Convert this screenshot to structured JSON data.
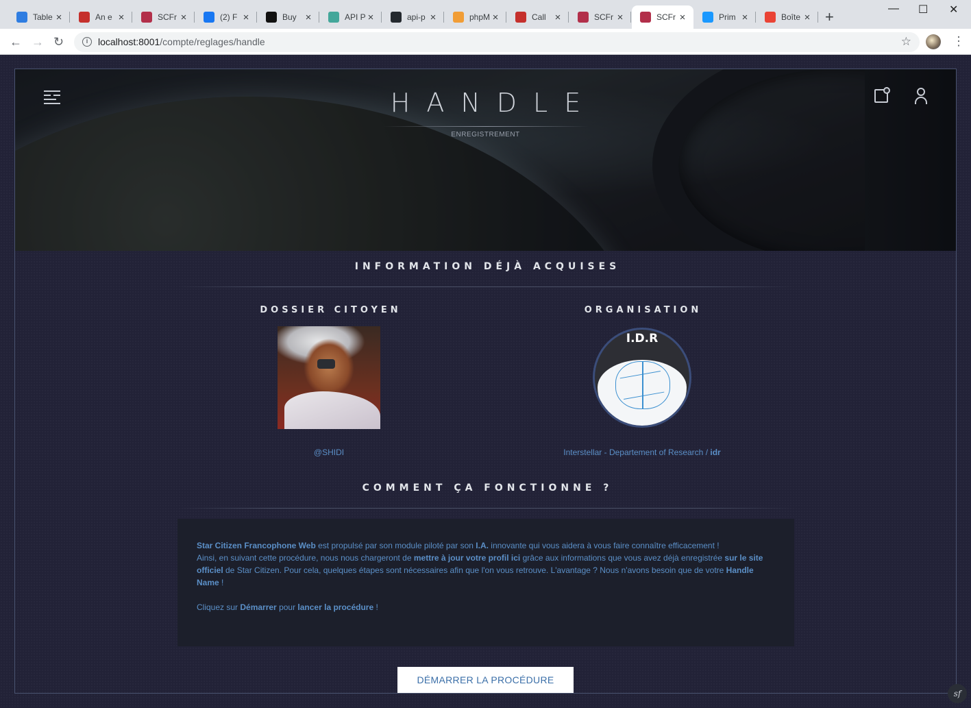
{
  "browser": {
    "tabs": [
      {
        "title": "Table",
        "color": "#2f7de1"
      },
      {
        "title": "An e",
        "color": "#c5302c"
      },
      {
        "title": "SCFr",
        "color": "#b22f4a"
      },
      {
        "title": "(2) F",
        "color": "#1877f2"
      },
      {
        "title": "Buy",
        "color": "#111111"
      },
      {
        "title": "API P",
        "color": "#43a79a"
      },
      {
        "title": "api-p",
        "color": "#24292e"
      },
      {
        "title": "phpM",
        "color": "#f19d36"
      },
      {
        "title": "Call",
        "color": "#c5302c"
      },
      {
        "title": "SCFr",
        "color": "#b22f4a"
      },
      {
        "title": "SCFr",
        "color": "#b22f4a",
        "active": true
      },
      {
        "title": "Prim",
        "color": "#1a98ff"
      },
      {
        "title": "Boîte",
        "color": "#ea4335"
      }
    ],
    "url_host": "localhost:8001",
    "url_path": "/compte/reglages/handle"
  },
  "header": {
    "title": "HANDLE",
    "subtitle": "ENREGISTREMENT"
  },
  "info": {
    "section_title": "INFORMATION DÉJÀ ACQUISES",
    "citizen": {
      "title": "DOSSIER CITOYEN",
      "handle": "@SHIDI"
    },
    "organisation": {
      "title": "ORGANISATION",
      "logo_text": "I.D.R",
      "name": "Interstellar - Departement of Research",
      "separator": " / ",
      "sid": "idr"
    }
  },
  "how": {
    "section_title": "COMMENT ÇA FONCTIONNE ?",
    "p1_brand": "Star Citizen Francophone Web",
    "p1_a": " est propulsé par son module piloté par son ",
    "p1_ia": "I.A.",
    "p1_b": " innovante qui vous aidera à vous faire connaître efficacement !",
    "p1_c": "Ainsi, en suivant cette procédure, nous nous chargeront de ",
    "p1_update": "mettre à jour votre profil ici",
    "p1_d": " grâce aux informations que vous avez déjà enregistrée ",
    "p1_site": "sur le site officiel",
    "p1_e": " de Star Citizen. Pour cela, quelques étapes sont nécessaires afin que l'on vous retrouve. L'avantage ? Nous n'avons besoin que de votre ",
    "p1_handle": "Handle Name",
    "p1_f": " !",
    "p2_a": "Cliquez sur ",
    "p2_start": "Démarrer",
    "p2_b": " pour ",
    "p2_launch": "lancer la procédure",
    "p2_c": " !"
  },
  "cta_label": "DÉMARRER LA PROCÉDURE",
  "colors": {
    "accent": "#5b8fc7",
    "background": "#222237",
    "panel": "#1c1f2b"
  }
}
